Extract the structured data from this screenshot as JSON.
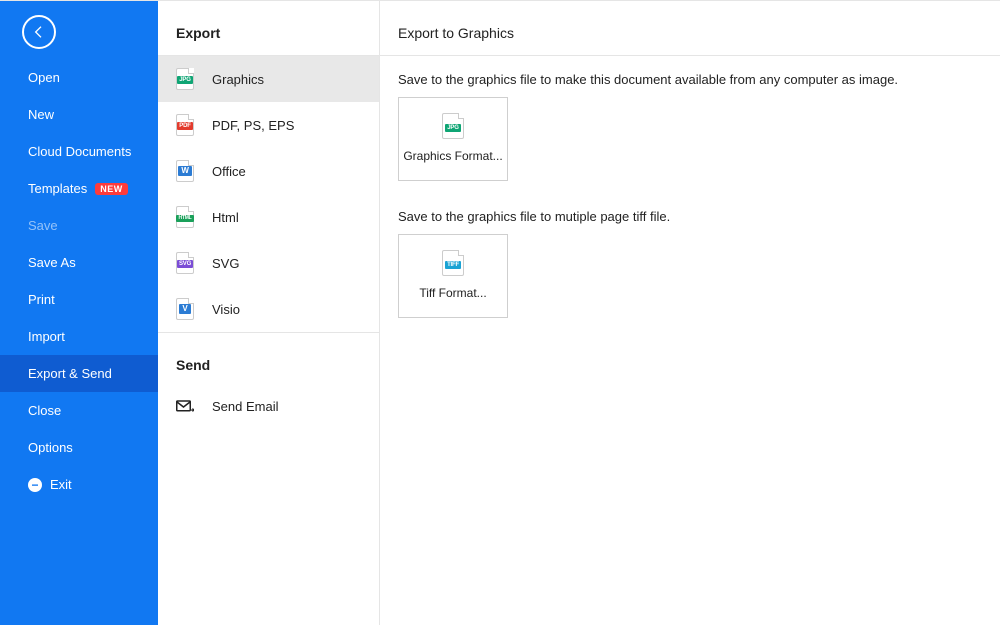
{
  "sidebar": {
    "items": [
      {
        "label": "Open"
      },
      {
        "label": "New"
      },
      {
        "label": "Cloud Documents"
      },
      {
        "label": "Templates",
        "badge": "NEW"
      },
      {
        "label": "Save",
        "dim": true
      },
      {
        "label": "Save As"
      },
      {
        "label": "Print"
      },
      {
        "label": "Import"
      },
      {
        "label": "Export & Send",
        "active": true
      },
      {
        "label": "Close"
      },
      {
        "label": "Options"
      },
      {
        "label": "Exit",
        "exitIcon": true
      }
    ]
  },
  "export": {
    "title": "Export",
    "items": [
      {
        "label": "Graphics",
        "type": "jpg",
        "tag": "JPG",
        "selected": true
      },
      {
        "label": "PDF, PS, EPS",
        "type": "pdf",
        "tag": "PDF"
      },
      {
        "label": "Office",
        "type": "w",
        "tag": "W"
      },
      {
        "label": "Html",
        "type": "html",
        "tag": "HTML"
      },
      {
        "label": "SVG",
        "type": "svg",
        "tag": "SVG"
      },
      {
        "label": "Visio",
        "type": "v",
        "tag": "V"
      }
    ]
  },
  "send": {
    "title": "Send",
    "items": [
      {
        "label": "Send Email"
      }
    ]
  },
  "main": {
    "title": "Export to Graphics",
    "desc1": "Save to the graphics file to make this document available from any computer as image.",
    "tile1": {
      "label": "Graphics Format...",
      "tag": "JPG",
      "type": "jpg"
    },
    "desc2": "Save to the graphics file to mutiple page tiff file.",
    "tile2": {
      "label": "Tiff Format...",
      "tag": "TIFF",
      "type": "tiff"
    }
  }
}
